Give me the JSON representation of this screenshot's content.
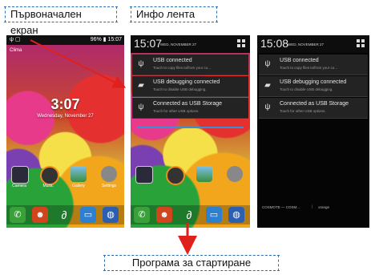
{
  "labels": {
    "home_screen": "Първоначален екран",
    "info_bar": "Инфо лента",
    "launch_program": "Програма за стартиране"
  },
  "phone1": {
    "status_right": "96% ▮ 15:07",
    "wallpaper_label": "Clima",
    "clock": "3:07",
    "date": "Wednesday, November 27",
    "apps": [
      "Camera",
      "Music",
      "Gallery",
      "Settings"
    ],
    "dock": [
      "phone-icon",
      "contacts-icon",
      "browser-icon",
      "messages-icon",
      "globe-icon"
    ]
  },
  "phone2": {
    "time": "15:07",
    "date": "WED, NOVEMBER 27",
    "notifications": [
      {
        "title": "USB connected",
        "sub": "Touch to copy files to/from your co...",
        "icon": "usb-icon"
      },
      {
        "title": "USB debugging connected",
        "sub": "Touch to disable USB debugging.",
        "icon": "android-icon"
      },
      {
        "title": "Connected as USB Storage",
        "sub": "Touch for other USB options.",
        "icon": "usb-icon"
      }
    ]
  },
  "phone3": {
    "time": "15:08",
    "date": "WED, NOVEMBER 27",
    "notifications": [
      {
        "title": "USB connected",
        "sub": "Touch to copy files to/from your co...",
        "icon": "usb-icon"
      },
      {
        "title": "USB debugging connected",
        "sub": "Touch to disable USB debugging.",
        "icon": "android-icon"
      },
      {
        "title": "Connected as USB Storage",
        "sub": "Touch for other USB options.",
        "icon": "usb-icon"
      }
    ],
    "carrier_left": "COSMOTE — COSM...",
    "carrier_right": "orange"
  },
  "colors": {
    "accent": "#2b6cb0",
    "arrow": "#e0201b",
    "panel_bg": "#232323"
  }
}
